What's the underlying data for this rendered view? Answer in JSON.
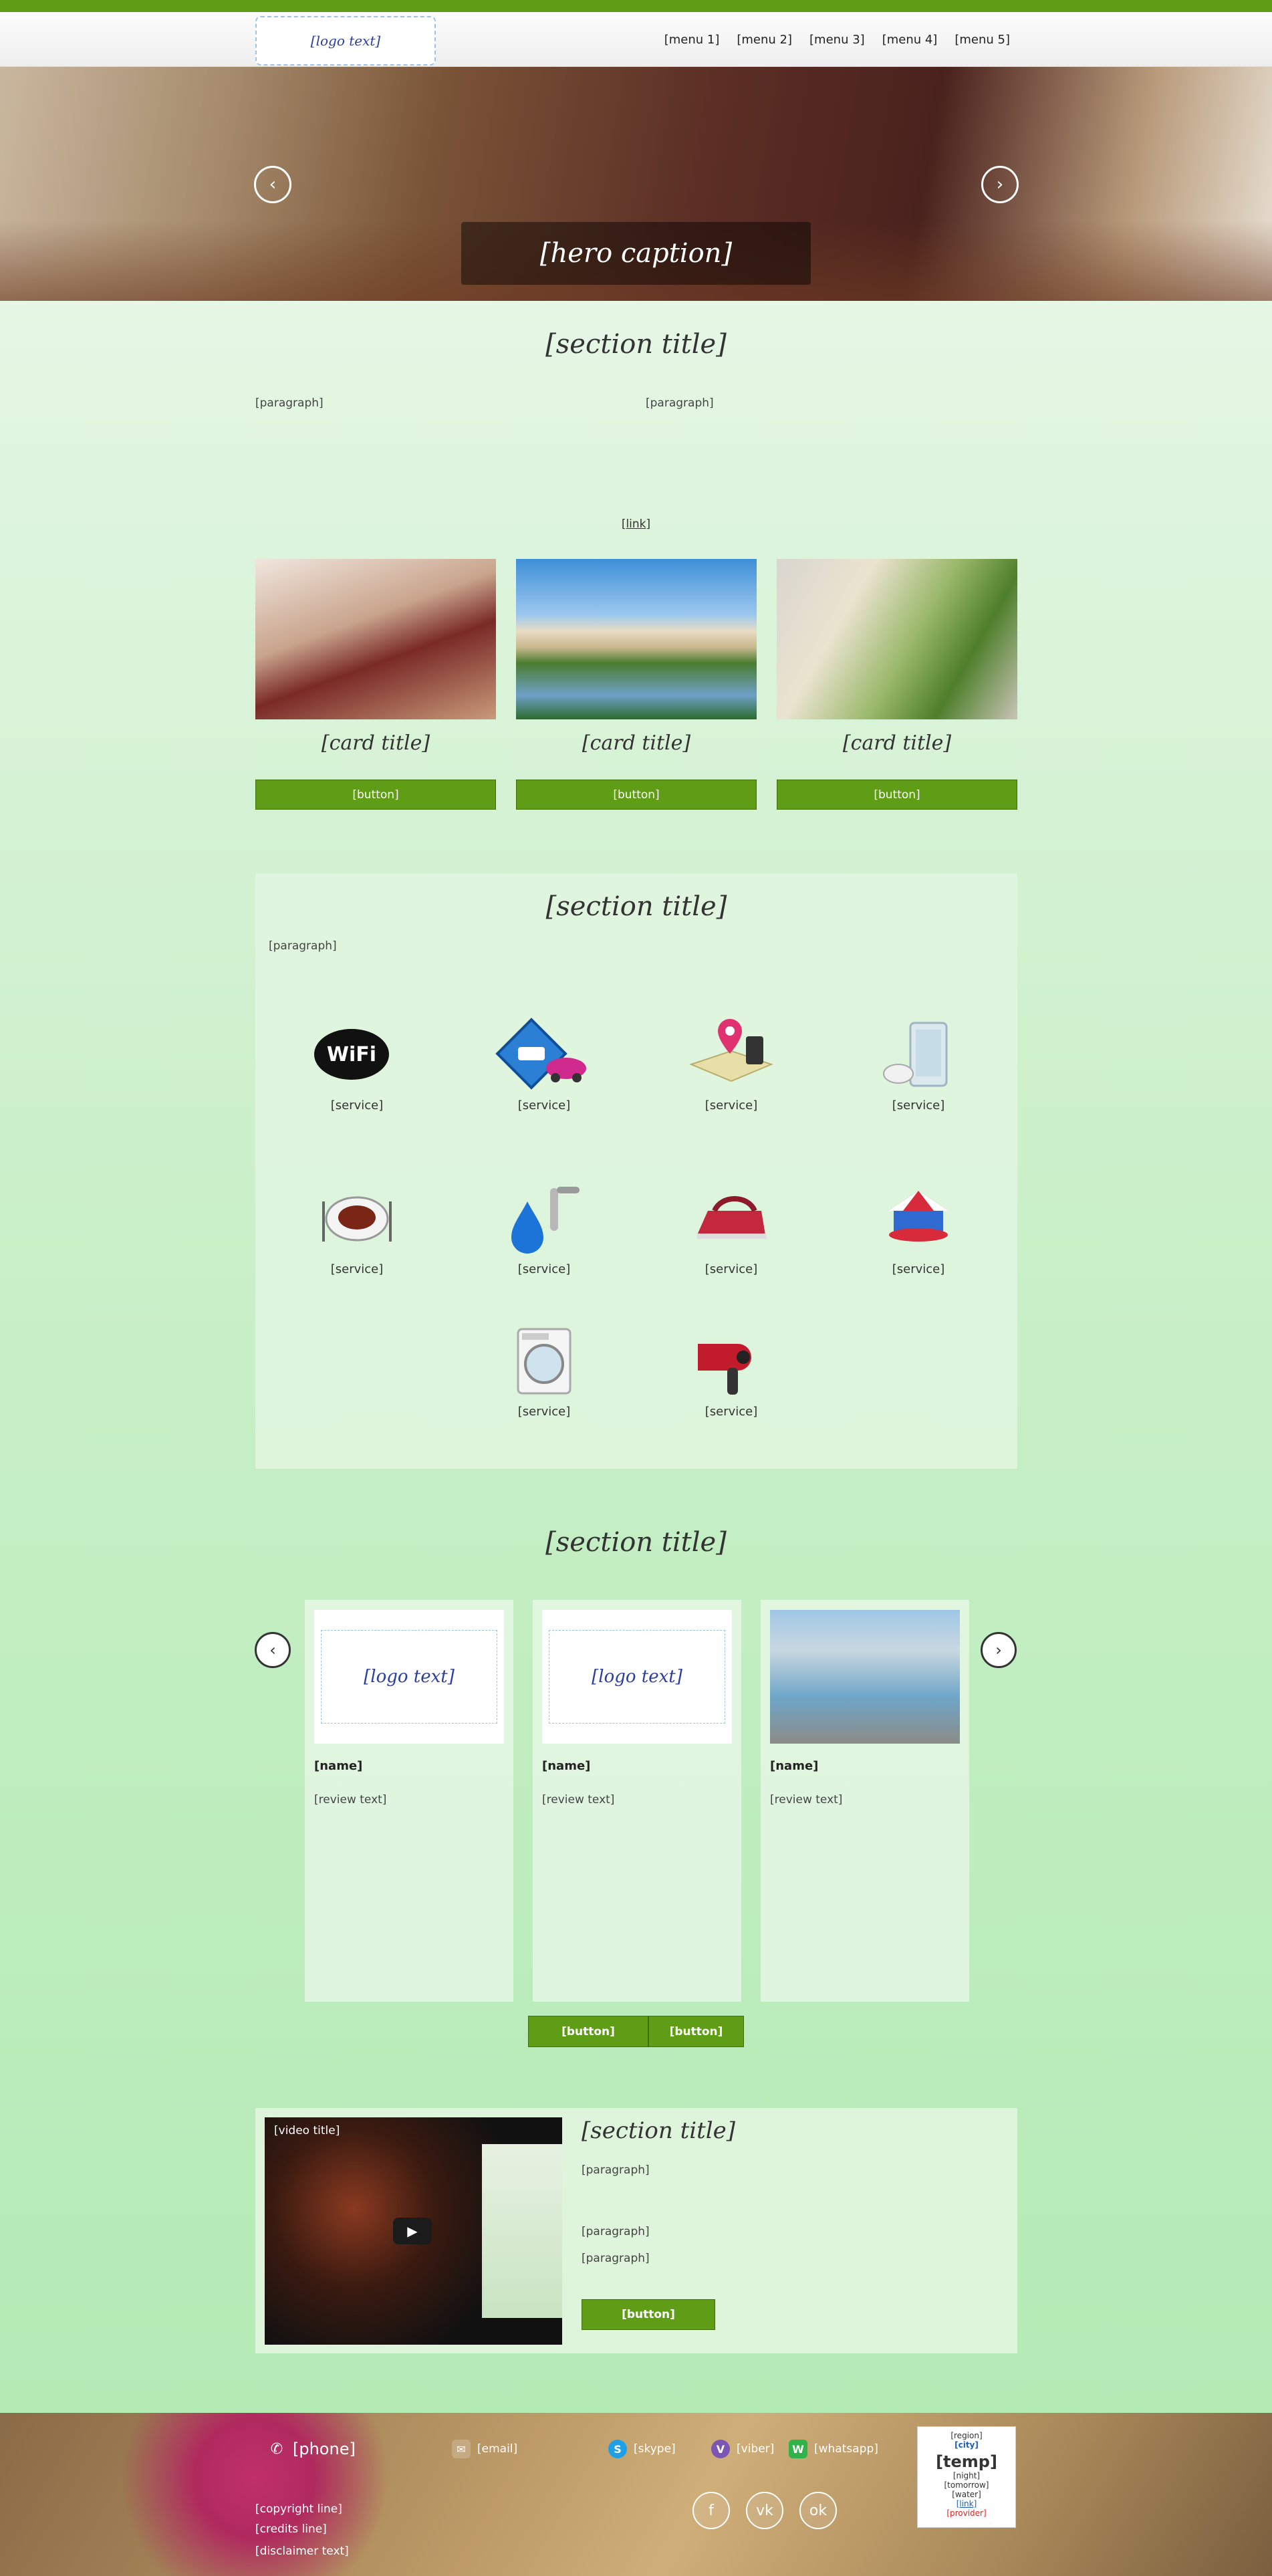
{
  "header": {
    "logo_text": "[logo text]",
    "nav": [
      "[menu 1]",
      "[menu 2]",
      "[menu 3]",
      "[menu 4]",
      "[menu 5]"
    ]
  },
  "hero": {
    "caption": "[hero caption]",
    "prev_glyph": "‹",
    "next_glyph": "›"
  },
  "about": {
    "title": "[section title]",
    "left": "[paragraph]",
    "right": "[paragraph]",
    "more": "[link]"
  },
  "cards": [
    {
      "title": "[card title]",
      "button": "[button]"
    },
    {
      "title": "[card title]",
      "button": "[button]"
    },
    {
      "title": "[card title]",
      "button": "[button]"
    }
  ],
  "services": {
    "title": "[section title]",
    "intro": "[paragraph]",
    "items": [
      {
        "label": "[service]",
        "icon": "wifi-icon"
      },
      {
        "label": "[service]",
        "icon": "parking-icon"
      },
      {
        "label": "[service]",
        "icon": "map-pin-icon"
      },
      {
        "label": "[service]",
        "icon": "shower-icon"
      },
      {
        "label": "[service]",
        "icon": "kitchen-icon"
      },
      {
        "label": "[service]",
        "icon": "water-tap-icon"
      },
      {
        "label": "[service]",
        "icon": "iron-icon"
      },
      {
        "label": "[service]",
        "icon": "carousel-icon"
      },
      {
        "label": "[service]",
        "icon": "washing-machine-icon"
      },
      {
        "label": "[service]",
        "icon": "hair-dryer-icon"
      }
    ]
  },
  "reviews": {
    "title": "[section title]",
    "items": [
      {
        "name": "[name]",
        "text": "[review text]"
      },
      {
        "name": "[name]",
        "text": "[review text]"
      },
      {
        "name": "[name]",
        "text": "[review text]"
      }
    ],
    "leave_button": "[button]",
    "all_button": "[button]"
  },
  "trip": {
    "video_title": "[video title]",
    "title": "[section title]",
    "p1": "[paragraph]",
    "p2": "[paragraph]",
    "p3": "[paragraph]",
    "button": "[button]"
  },
  "footer": {
    "phone": "[phone]",
    "email": "[email]",
    "skype": "[skype]",
    "viber": "[viber]",
    "whatsapp": "[whatsapp]",
    "copyright": "[copyright line]",
    "dev": "[credits line]",
    "disclaimer": "[disclaimer text]",
    "weather": {
      "region": "[region]",
      "city": "[city]",
      "temp": "[temp]",
      "night": "[night]",
      "tomorrow": "[tomorrow]",
      "water": "[water]",
      "forecast_link": "[link]",
      "provider": "[provider]"
    }
  },
  "colors": {
    "accent": "#5f9d16",
    "topbar": "#5f9d16"
  }
}
